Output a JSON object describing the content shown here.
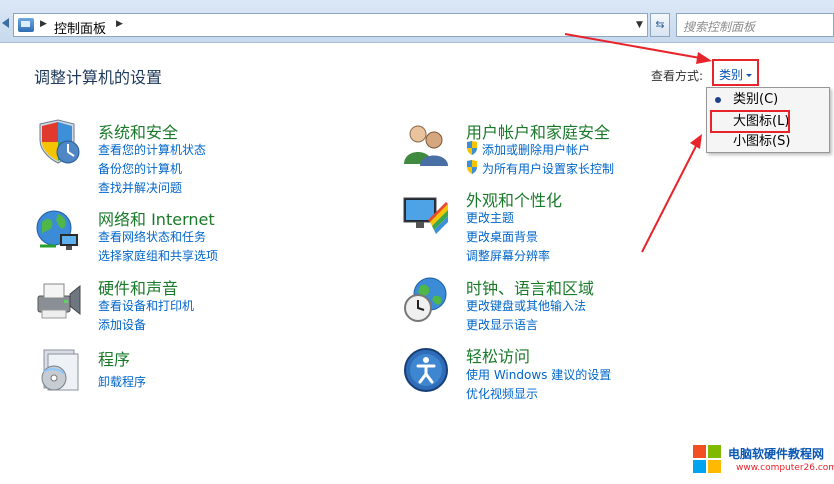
{
  "address_bar": {
    "crumb": "控制面板",
    "search_placeholder": "搜索控制面板"
  },
  "header": {
    "title": "调整计算机的设置",
    "view_label": "查看方式:",
    "view_value": "类别"
  },
  "view_menu": {
    "items": [
      {
        "label": "类别(C)",
        "selected": true
      },
      {
        "label": "大图标(L)",
        "selected": false
      },
      {
        "label": "小图标(S)",
        "selected": false
      }
    ]
  },
  "categories_left": [
    {
      "title": "系统和安全",
      "icon": "system-security-icon",
      "links": [
        "查看您的计算机状态",
        "备份您的计算机",
        "查找并解决问题"
      ]
    },
    {
      "title": "网络和 Internet",
      "icon": "network-internet-icon",
      "links": [
        "查看网络状态和任务",
        "选择家庭组和共享选项"
      ]
    },
    {
      "title": "硬件和声音",
      "icon": "hardware-sound-icon",
      "links": [
        "查看设备和打印机",
        "添加设备"
      ]
    },
    {
      "title": "程序",
      "icon": "programs-icon",
      "links": [
        "卸载程序"
      ]
    }
  ],
  "categories_right": [
    {
      "title": "用户帐户和家庭安全",
      "icon": "user-accounts-icon",
      "links": [
        "添加或删除用户帐户",
        "为所有用户设置家长控制"
      ]
    },
    {
      "title": "外观和个性化",
      "icon": "appearance-icon",
      "links": [
        "更改主题",
        "更改桌面背景",
        "调整屏幕分辨率"
      ]
    },
    {
      "title": "时钟、语言和区域",
      "icon": "clock-language-icon",
      "links": [
        "更改键盘或其他输入法",
        "更改显示语言"
      ]
    },
    {
      "title": "轻松访问",
      "icon": "ease-of-access-icon",
      "links": [
        "使用 Windows 建议的设置",
        "优化视频显示"
      ]
    }
  ],
  "watermark": {
    "line1": "电脑软硬件教程网",
    "line2": "www.computer26.com"
  },
  "colors": {
    "accent_red": "#e8242b",
    "link_blue": "#0066cc",
    "title_green": "#1a7a2a"
  }
}
